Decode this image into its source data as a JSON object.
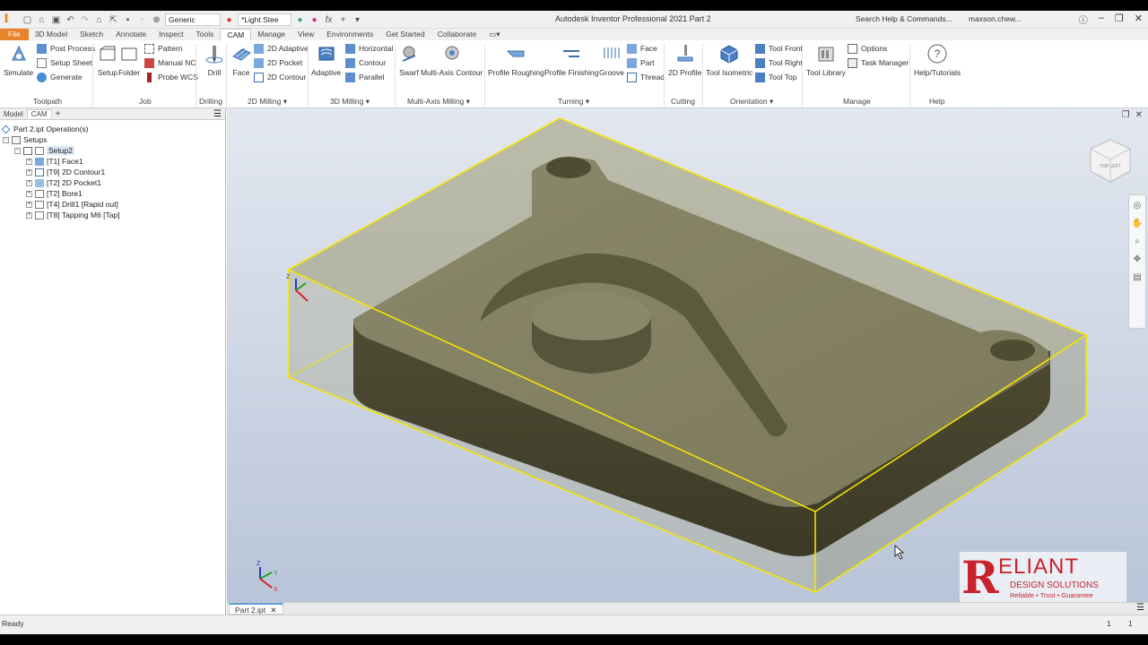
{
  "window": {
    "app_title": "Autodesk Inventor Professional 2021   Part 2",
    "search_placeholder": "Search Help & Commands...",
    "user": "maxson.chew...",
    "material": "Generic",
    "appearance": "*Light Stee"
  },
  "tabs": [
    "File",
    "3D Model",
    "Sketch",
    "Annotate",
    "Inspect",
    "Tools",
    "CAM",
    "Manage",
    "View",
    "Environments",
    "Get Started",
    "Collaborate"
  ],
  "active_tab": "CAM",
  "ribbon": {
    "simulate": "Simulate",
    "post_process": "Post Process",
    "setup_sheet": "Setup Sheet",
    "generate": "Generate",
    "toolpath_label": "Toolpath",
    "setup": "Setup",
    "folder": "Folder",
    "pattern": "Pattern",
    "manual_nc": "Manual NC",
    "probe_wcs": "Probe WCS",
    "job_label": "Job",
    "drill": "Drill",
    "drilling_label": "Drilling",
    "face": "Face",
    "adaptive_2d": "2D Adaptive",
    "pocket_2d": "2D Pocket",
    "contour_2d": "2D Contour",
    "milling_2d_label": "2D Milling",
    "adaptive": "Adaptive",
    "horizontal": "Horizontal",
    "contour": "Contour",
    "parallel": "Parallel",
    "milling_3d_label": "3D Milling",
    "swarf": "Swarf",
    "multi_axis_contour": "Multi-Axis Contour",
    "multi_axis_label": "Multi-Axis Milling",
    "profile_roughing": "Profile Roughing",
    "profile_finishing": "Profile Finishing",
    "groove": "Groove",
    "t_face": "Face",
    "t_part": "Part",
    "t_thread": "Thread",
    "turning_label": "Turning",
    "profile_2d": "2D Profile",
    "cutting_label": "Cutting",
    "tool_isometric": "Tool Isometric",
    "tool_front": "Tool Front",
    "tool_right": "Tool Right",
    "tool_top": "Tool Top",
    "orientation_label": "Orientation",
    "tool_library": "Tool Library",
    "options": "Options",
    "task_manager": "Task Manager",
    "manage_label": "Manage",
    "help_tutorials": "Help/Tutorials",
    "help_label": "Help"
  },
  "browser": {
    "tab_model": "Model",
    "tab_cam": "CAM",
    "root": "Part 2.ipt Operation(s)",
    "setups": "Setups",
    "setup2": "Setup2",
    "ops": [
      "[T1] Face1",
      "[T9] 2D Contour1",
      "[T2] 2D Pocket1",
      "[T2] Bore1",
      "[T4] Drill1 [Rapid out]",
      "[T8] Tapping M6 [Tap]"
    ]
  },
  "viewcube": {
    "label": "TOP LEFT"
  },
  "doc_tab": "Part 2.ipt",
  "status": {
    "text": "Ready",
    "n1": "1",
    "n2": "1"
  },
  "logo": {
    "name": "ELIANT",
    "initial": "R",
    "sub": "DESIGN SOLUTIONS",
    "tagline": "Reliable • Trust • Guarantee"
  },
  "triad": {
    "z": "Z",
    "y": "Y",
    "x": "X"
  },
  "colors": {
    "accent": "#e8832b",
    "stock_edge": "#f5e400",
    "part": "#5f5d3a",
    "logo_red": "#c8232c"
  }
}
